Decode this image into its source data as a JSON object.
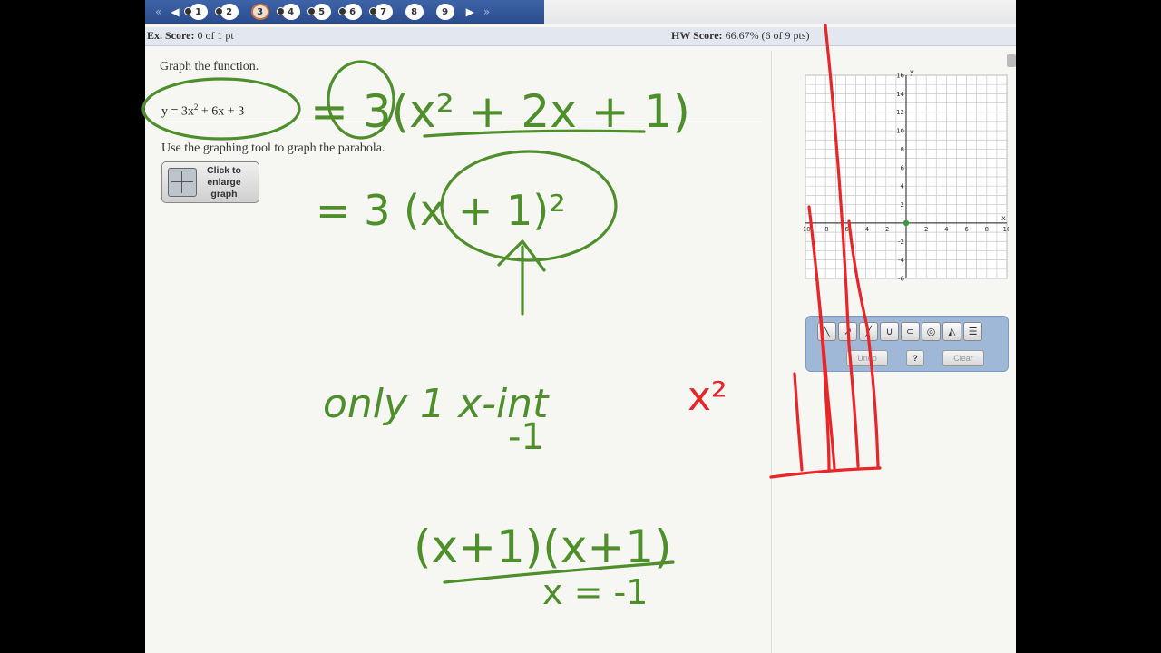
{
  "nav": {
    "prev_all": "«",
    "prev": "◀",
    "next": "▶",
    "next_all": "»",
    "questions": [
      "1",
      "2",
      "3",
      "4",
      "5",
      "6",
      "7",
      "8",
      "9"
    ],
    "current_question": "3"
  },
  "scores": {
    "ex_label": "Ex. Score:",
    "ex_value": "0 of 1 pt",
    "hw_label": "HW Score:",
    "hw_value": "66.67% (6 of 9 pts)"
  },
  "question": {
    "instruction": "Graph the function.",
    "equation_lhs": "y = 3x",
    "equation_exp": "2",
    "equation_rhs": " + 6x + 3",
    "tool_instruction": "Use the graphing tool to graph the parabola.",
    "enlarge_label": "Click to enlarge graph"
  },
  "graph": {
    "x_axis_label": "x",
    "y_axis_label": "y",
    "x_ticks": [
      "-10",
      "-8",
      "-6",
      "-4",
      "-2",
      "2",
      "4",
      "6",
      "8",
      "10"
    ],
    "y_ticks": [
      "16",
      "14",
      "12",
      "10",
      "8",
      "6",
      "4",
      "2",
      "-2",
      "-4",
      "-6"
    ],
    "x_range": [
      -10,
      10
    ],
    "y_range": [
      -6,
      16
    ],
    "grid": true,
    "point": {
      "x": 0,
      "y": 0,
      "color": "#3a9a3a"
    }
  },
  "palette": {
    "tools": [
      "line-tool-icon",
      "ray-tool-icon",
      "segment-tool-icon",
      "parabola-tool-icon",
      "curve-tool-icon",
      "circle-tool-icon",
      "fill-tool-icon",
      "menu-icon"
    ],
    "undo_label": "Undo",
    "help_label": "?",
    "clear_label": "Clear"
  },
  "handwriting": {
    "factored_a": "= 3(x² + 2x + 1)",
    "factored_b": "= 3 (x + 1)²",
    "note_1": "only 1 x-int",
    "note_2": "-1",
    "product": "(x+1)(x+1)",
    "root": "x = -1",
    "red_note": "x²"
  },
  "colors": {
    "nav_blue": "#2b4c8c",
    "ink_green": "#4e8f2c",
    "ink_red": "#e8262a"
  }
}
